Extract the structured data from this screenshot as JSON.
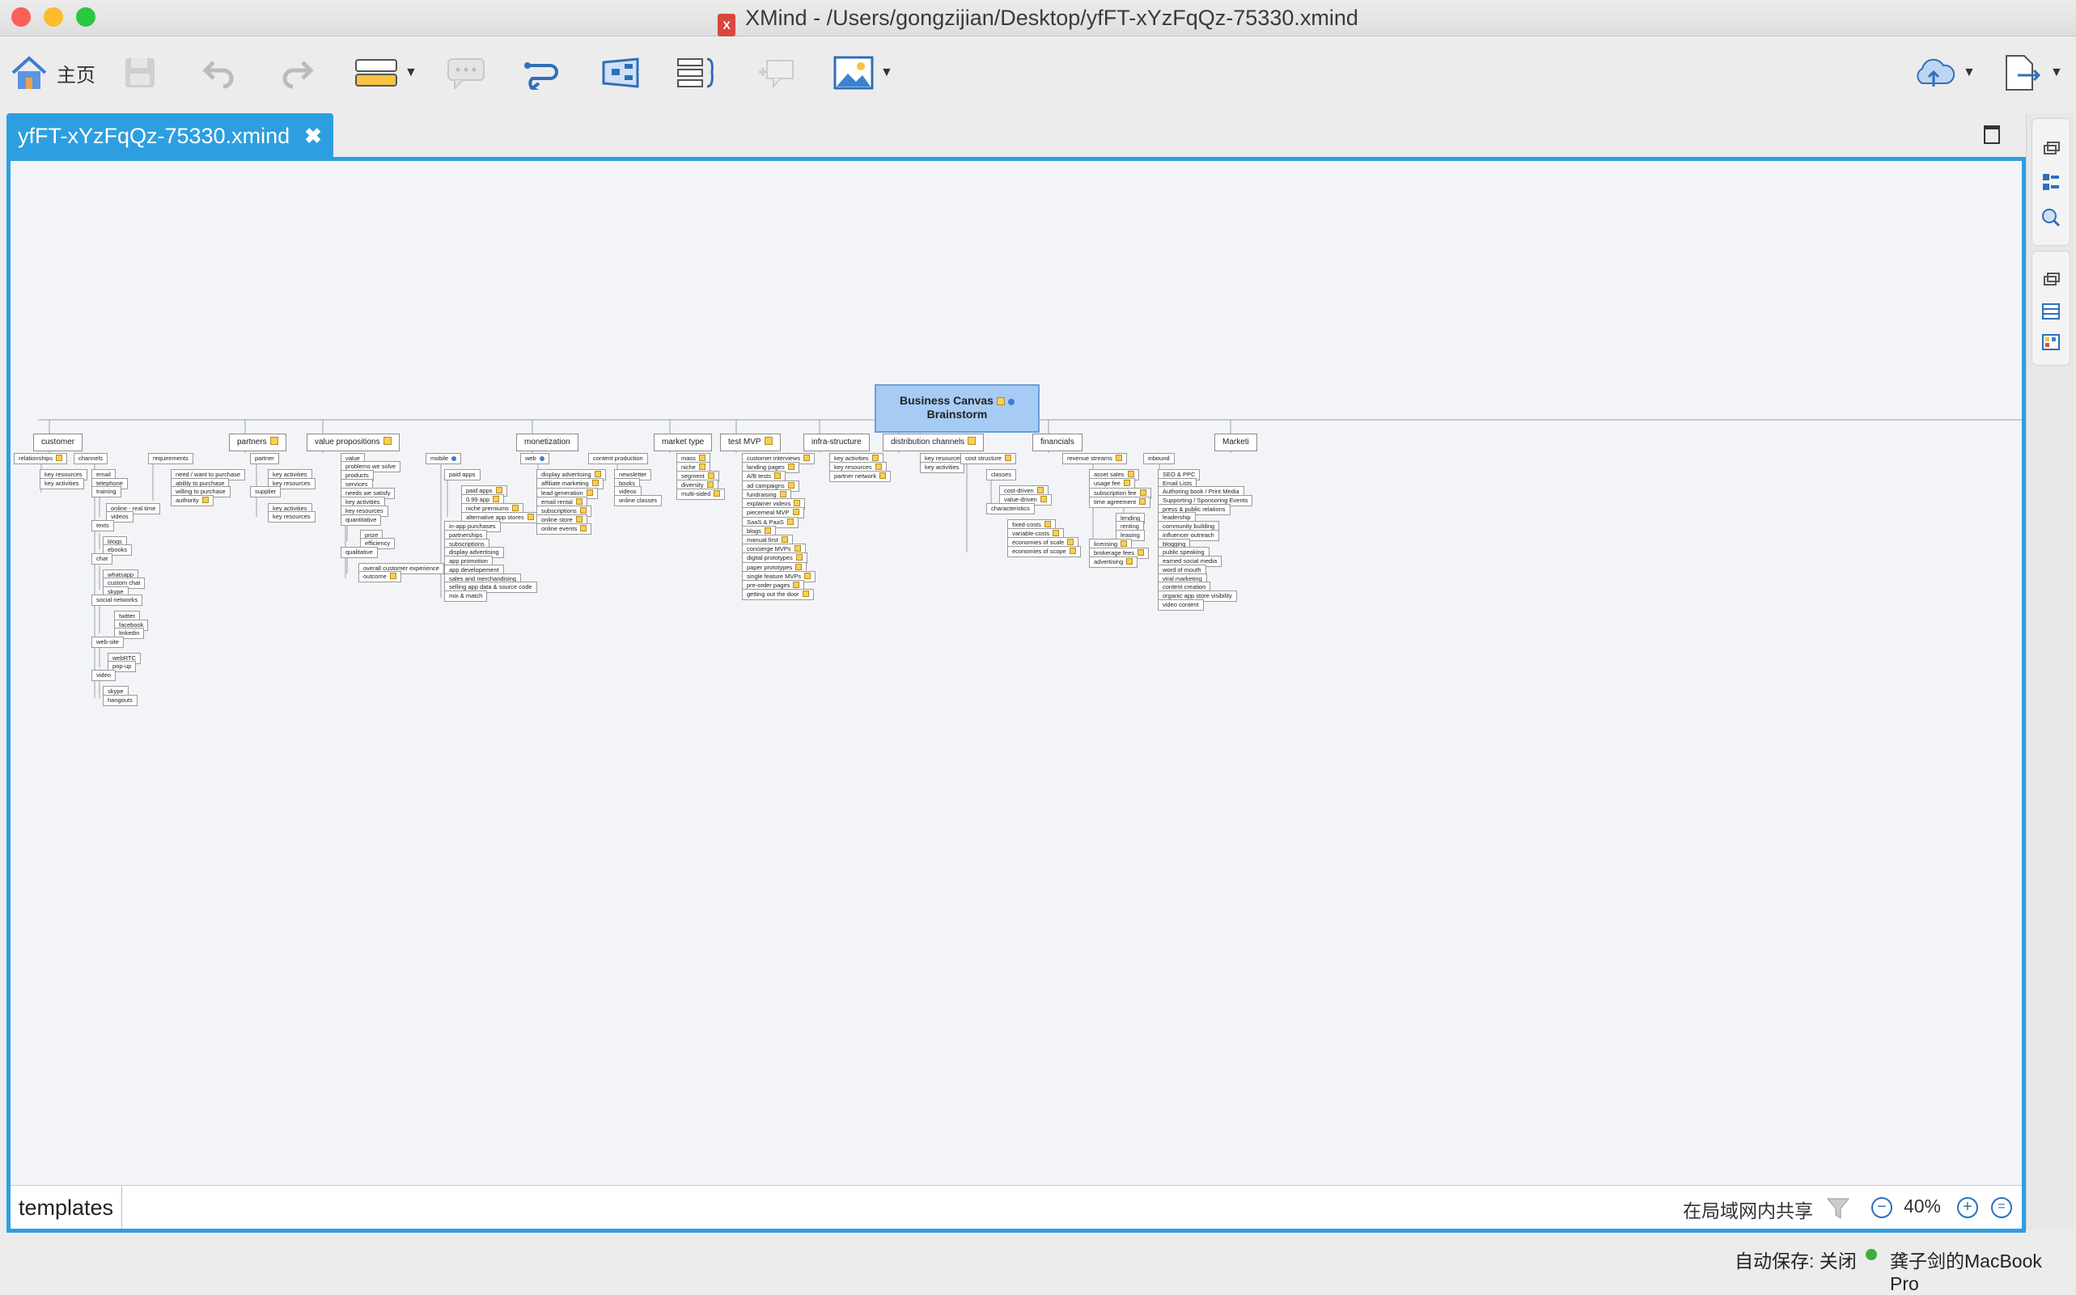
{
  "window": {
    "title": "XMind - /Users/gongzijian/Desktop/yfFT-xYzFqQz-75330.xmind",
    "traffic_colors": [
      "#fc5f57",
      "#fdbc2e",
      "#29c840"
    ]
  },
  "toolbar": {
    "home_label": "主页",
    "icons": [
      "home-icon",
      "save-icon",
      "undo-icon",
      "redo-icon",
      "topic-icon",
      "comment-icon",
      "relationship-icon",
      "boundary-icon",
      "summary-icon",
      "callout-icon",
      "image-icon",
      "share-icon",
      "export-icon"
    ]
  },
  "tab": {
    "label": "yfFT-xYzFqQz-75330.xmind",
    "close": "✖"
  },
  "bottom": {
    "templates": "templates",
    "share": "在局域网内共享",
    "zoom": "40%"
  },
  "status": {
    "autosave": "自动保存: 关闭",
    "device": "龚子剑的MacBook Pro"
  },
  "mindmap": {
    "root": [
      "Business Canvas",
      "Brainstorm"
    ],
    "branches": [
      {
        "id": "customer",
        "label": "customer"
      },
      {
        "id": "partners",
        "label": "partners",
        "note": true
      },
      {
        "id": "value",
        "label": "value propositions",
        "note": true
      },
      {
        "id": "monet",
        "label": "monetization"
      },
      {
        "id": "market",
        "label": "market type"
      },
      {
        "id": "mvp",
        "label": "test MVP",
        "note": true
      },
      {
        "id": "infra",
        "label": "infra-structure"
      },
      {
        "id": "dist",
        "label": "distribution channels",
        "note": true
      },
      {
        "id": "fin",
        "label": "financials"
      },
      {
        "id": "mkt",
        "label": "Marketi"
      }
    ],
    "leaves": [
      {
        "t": "relationships",
        "n": true
      },
      {
        "t": "key resources"
      },
      {
        "t": "key activities"
      },
      {
        "t": "channels"
      },
      {
        "t": "email"
      },
      {
        "t": "telephone"
      },
      {
        "t": "training"
      },
      {
        "t": "online - real time"
      },
      {
        "t": "videos"
      },
      {
        "t": "texts"
      },
      {
        "t": "blogs"
      },
      {
        "t": "ebooks"
      },
      {
        "t": "chat"
      },
      {
        "t": "whatsapp"
      },
      {
        "t": "custom chat"
      },
      {
        "t": "skype"
      },
      {
        "t": "social networks"
      },
      {
        "t": "twitter"
      },
      {
        "t": "facebook"
      },
      {
        "t": "linkedin"
      },
      {
        "t": "web-site"
      },
      {
        "t": "webRTC"
      },
      {
        "t": "pop-up"
      },
      {
        "t": "video"
      },
      {
        "t": "skype"
      },
      {
        "t": "hangouts"
      },
      {
        "t": "requirements"
      },
      {
        "t": "need / want to purchase"
      },
      {
        "t": "ability to purchase"
      },
      {
        "t": "willing to purchase"
      },
      {
        "t": "authority",
        "n": true
      },
      {
        "t": "partner"
      },
      {
        "t": "key activities"
      },
      {
        "t": "key resources"
      },
      {
        "t": "supplier"
      },
      {
        "t": "key activities"
      },
      {
        "t": "key resources"
      },
      {
        "t": "value"
      },
      {
        "t": "problems we solve"
      },
      {
        "t": "products"
      },
      {
        "t": "services"
      },
      {
        "t": "needs we satisfy"
      },
      {
        "t": "key activities"
      },
      {
        "t": "key resources"
      },
      {
        "t": "quantitative"
      },
      {
        "t": "prize"
      },
      {
        "t": "efficiency"
      },
      {
        "t": "qualitative"
      },
      {
        "t": "overall customer experience"
      },
      {
        "t": "outcome",
        "n": true
      },
      {
        "t": "mobile",
        "g": true
      },
      {
        "t": "paid apps"
      },
      {
        "t": "paid apps",
        "n": true
      },
      {
        "t": "0.99 app",
        "n": true
      },
      {
        "t": "niche premiums",
        "n": true
      },
      {
        "t": "alternative app stores",
        "n": true
      },
      {
        "t": "in-app purchases"
      },
      {
        "t": "partnerships"
      },
      {
        "t": "subscriptions"
      },
      {
        "t": "display advertising"
      },
      {
        "t": "app promotion"
      },
      {
        "t": "app developement"
      },
      {
        "t": "sales and merchandising"
      },
      {
        "t": "selling app data & source code"
      },
      {
        "t": "mix & match"
      },
      {
        "t": "web",
        "g": true
      },
      {
        "t": "display advertising",
        "n": true
      },
      {
        "t": "affiliate marketing",
        "n": true
      },
      {
        "t": "lead generation",
        "n": true
      },
      {
        "t": "email rental",
        "n": true
      },
      {
        "t": "subscriptions",
        "n": true
      },
      {
        "t": "online store",
        "n": true
      },
      {
        "t": "online events",
        "n": true
      },
      {
        "t": "content production"
      },
      {
        "t": "newsletter"
      },
      {
        "t": "books"
      },
      {
        "t": "videos"
      },
      {
        "t": "online classes"
      },
      {
        "t": "mass",
        "n": true
      },
      {
        "t": "niche",
        "n": true
      },
      {
        "t": "segment",
        "n": true
      },
      {
        "t": "diversity",
        "n": true
      },
      {
        "t": "multi-sided",
        "n": true
      },
      {
        "t": "customer interviews",
        "n": true
      },
      {
        "t": "landing pages",
        "n": true
      },
      {
        "t": "A/B tests",
        "n": true
      },
      {
        "t": "ad campaigns",
        "n": true
      },
      {
        "t": "fundraising",
        "n": true
      },
      {
        "t": "explainer videos",
        "n": true
      },
      {
        "t": "piecemeal MVP",
        "n": true
      },
      {
        "t": "SaaS & PaaS",
        "n": true
      },
      {
        "t": "blogs",
        "n": true
      },
      {
        "t": "manual first",
        "n": true
      },
      {
        "t": "concierge MVPs",
        "n": true
      },
      {
        "t": "digital prototypes",
        "n": true
      },
      {
        "t": "paper prototypes",
        "n": true
      },
      {
        "t": "single feature MVPs",
        "n": true
      },
      {
        "t": "pre-order pages",
        "n": true
      },
      {
        "t": "getting out the door",
        "n": true
      },
      {
        "t": "key activities",
        "n": true
      },
      {
        "t": "key resources",
        "n": true
      },
      {
        "t": "partner network",
        "n": true
      },
      {
        "t": "key resources"
      },
      {
        "t": "key activities"
      },
      {
        "t": "cost structure",
        "n": true
      },
      {
        "t": "classes"
      },
      {
        "t": "cost-driven",
        "n": true
      },
      {
        "t": "value-driven",
        "n": true
      },
      {
        "t": "characteristics"
      },
      {
        "t": "fixed-costs",
        "n": true
      },
      {
        "t": "variable-costs",
        "n": true
      },
      {
        "t": "economies of scale",
        "n": true
      },
      {
        "t": "economies of scope",
        "n": true
      },
      {
        "t": "revenue streams",
        "n": true
      },
      {
        "t": "asset sales",
        "n": true
      },
      {
        "t": "usage fee",
        "n": true
      },
      {
        "t": "subscription fee",
        "n": true
      },
      {
        "t": "time agreement",
        "n": true
      },
      {
        "t": "lending"
      },
      {
        "t": "renting"
      },
      {
        "t": "leasing"
      },
      {
        "t": "licensing",
        "n": true
      },
      {
        "t": "brokerage fees",
        "n": true
      },
      {
        "t": "advertising",
        "n": true
      },
      {
        "t": "inbound"
      },
      {
        "t": "SEO & PPC"
      },
      {
        "t": "Email Lists"
      },
      {
        "t": "Authoring book / Print Media"
      },
      {
        "t": "Supporting / Sponsoring Events"
      },
      {
        "t": "press & public relations"
      },
      {
        "t": "leadership"
      },
      {
        "t": "community building"
      },
      {
        "t": "influencer outreach"
      },
      {
        "t": "blogging"
      },
      {
        "t": "public speaking"
      },
      {
        "t": "earned social media"
      },
      {
        "t": "word of mouth"
      },
      {
        "t": "viral marketing"
      },
      {
        "t": "content creation"
      },
      {
        "t": "organic app store visibility"
      },
      {
        "t": "video content"
      }
    ]
  }
}
